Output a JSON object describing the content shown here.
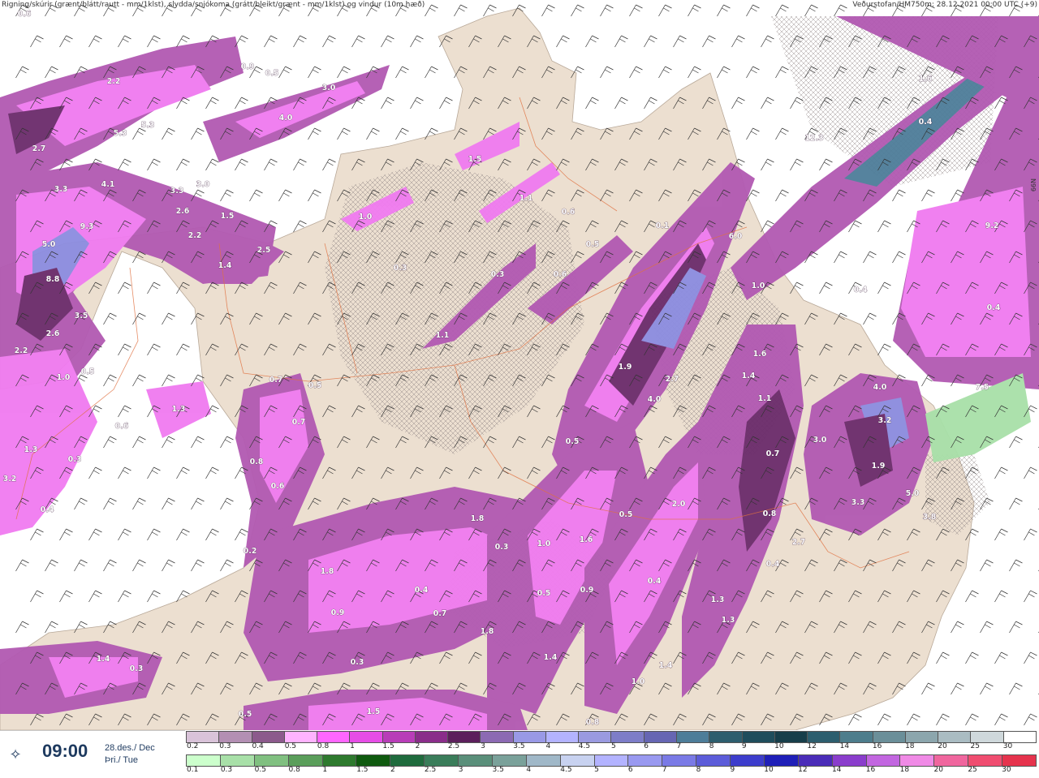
{
  "header": {
    "left": "Rigning/skúrir (grænt/blátt/rautt - mm/1klst), slydda/snjókoma (grátt/bleikt/grænt - mm/1klst) og vindur (10m hæð)",
    "right": "Veðurstofan/HM750m: 28.12.2021 00:00 UTC (+9)"
  },
  "edge_label": "66N",
  "time_panel": {
    "logo_icon": "vedurstofan-logo-icon",
    "time": "09:00",
    "date_line1": "28.des./ Dec",
    "date_line2": "Þri./ Tue"
  },
  "colors": {
    "land": "#ecdfd0",
    "sea": "#ffffff",
    "precip_light": "#f07af0",
    "precip_mid": "#b259b2",
    "precip_dark": "#6b2b6b",
    "precip_blue": "#8c8ce0",
    "rain_green": "#a8e0a8",
    "roads": "#e07040"
  },
  "snow_scale": {
    "ticks": [
      "0.2",
      "0.3",
      "0.4",
      "0.5",
      "0.8",
      "1",
      "1.5",
      "2",
      "2.5",
      "3",
      "3.5",
      "4",
      "4.5",
      "5",
      "6",
      "7",
      "8",
      "9",
      "10",
      "12",
      "14",
      "16",
      "18",
      "20",
      "25",
      "30"
    ],
    "colors": [
      "#d9c3d9",
      "#b38fb3",
      "#8c5a8c",
      "#ffb3ff",
      "#ff66ff",
      "#e64de6",
      "#b83db8",
      "#8a2d8a",
      "#5c1f5c",
      "#8c6ab3",
      "#9999e6",
      "#b3b3ff",
      "#9a9ae0",
      "#7d7dc8",
      "#6666b3",
      "#4d7d99",
      "#2d5e6e",
      "#1f4d5c",
      "#173e4a",
      "#2d5e6e",
      "#4d7d8c",
      "#6b8f99",
      "#8ca6ad",
      "#aabcc2",
      "#cfd8db",
      "#ffffff"
    ]
  },
  "rain_scale": {
    "ticks": [
      "0.1",
      "0.3",
      "0.5",
      "0.8",
      "1",
      "1.5",
      "2",
      "2.5",
      "3",
      "3.5",
      "4",
      "4.5",
      "5",
      "6",
      "7",
      "8",
      "9",
      "10",
      "12",
      "14",
      "16",
      "18",
      "20",
      "25",
      "30"
    ],
    "colors": [
      "#ccffcc",
      "#a8e0a8",
      "#80c080",
      "#5a9e5a",
      "#2e7a2e",
      "#0f5a0f",
      "#1f6b3d",
      "#3a7d5a",
      "#5a8f7a",
      "#7aa19a",
      "#a0b8c8",
      "#c8d2f0",
      "#b3b3ff",
      "#9999f0",
      "#7a7ae6",
      "#5c5cd9",
      "#3d3dcc",
      "#1f1fb8",
      "#4a2cb8",
      "#8a3dcc",
      "#c266e0",
      "#f08ae6",
      "#f0669e",
      "#f04d70",
      "#e6334d"
    ]
  },
  "map_labels": [
    "0.6",
    "2.2",
    "0.9",
    "0.5",
    "3.0",
    "4.0",
    "5.3",
    "5.3",
    "2.7",
    "3.3",
    "4.1",
    "3.3",
    "3.0",
    "9.3",
    "2.6",
    "2.2",
    "1.5",
    "2.5",
    "1.4",
    "5.0",
    "8.8",
    "3.5",
    "2.6",
    "2.2",
    "1.0",
    "0.5",
    "1.3",
    "0.6",
    "1.3",
    "0.3",
    "3.2",
    "0.4",
    "0.7",
    "0.5",
    "0.7",
    "0.8",
    "0.6",
    "0.2",
    "1.5",
    "1.0",
    "1.1",
    "0.6",
    "0.5",
    "0.3",
    "0.3",
    "0.6",
    "1.1",
    "0.4",
    "0.4",
    "12.3",
    "0.1",
    "6.0",
    "9.2",
    "1.0",
    "1.6",
    "0.4",
    "1.6",
    "1.4",
    "1.1",
    "1.9",
    "2.7",
    "4.0",
    "4.0",
    "3.2",
    "7.5",
    "0.5",
    "0.7",
    "3.0",
    "1.9",
    "5.0",
    "3.3",
    "3.8",
    "2.0",
    "0.5",
    "0.8",
    "2.7",
    "1.8",
    "0.3",
    "1.0",
    "1.6",
    "1.8",
    "0.4",
    "0.9",
    "0.5",
    "0.9",
    "0.7",
    "0.4",
    "1.8",
    "0.4",
    "1.3",
    "1.3",
    "0.3",
    "1.4",
    "1.4",
    "1.4",
    "1.0",
    "0.3",
    "1.5",
    "0.8",
    "0.5"
  ]
}
